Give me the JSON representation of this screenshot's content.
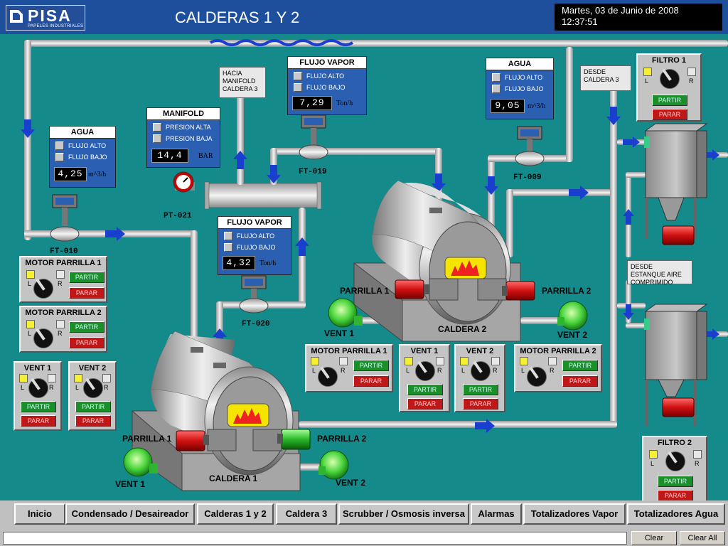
{
  "header": {
    "logo_text": "PISA",
    "logo_sub": "PAPELES INDUSTRIALES",
    "title": "CALDERAS 1 Y 2",
    "date": "Martes, 03 de Junio de 2008",
    "time": "12:37:51"
  },
  "indicators": {
    "agua_1": {
      "title": "AGUA",
      "alto": "FLUJO ALTO",
      "bajo": "FLUJO BAJO",
      "value": "4,25",
      "unit": "m^3/h"
    },
    "manifold": {
      "title": "MANIFOLD",
      "alto": "PRESION ALTA",
      "bajo": "PRESION BAJA",
      "value": "14,4",
      "unit": "BAR"
    },
    "vapor_2": {
      "title": "FLUJO VAPOR",
      "alto": "FLUJO ALTO",
      "bajo": "FLUJO BAJO",
      "value": "7,29",
      "unit": "Ton/h"
    },
    "agua_2": {
      "title": "AGUA",
      "alto": "FLUJO ALTO",
      "bajo": "FLUJO BAJO",
      "value": "9,05",
      "unit": "m^3/h"
    },
    "vapor_1": {
      "title": "FLUJO VAPOR",
      "alto": "FLUJO ALTO",
      "bajo": "FLUJO BAJO",
      "value": "4,32",
      "unit": "Ton/h"
    }
  },
  "tags": {
    "ft010": "FT-010",
    "ft019": "FT-019",
    "ft009": "FT-009",
    "ft020": "FT-020",
    "pt021": "PT-021"
  },
  "notes": {
    "hacia": "HACIA MANIFOLD CALDERA 3",
    "desde_cal3": "DESDE CALDERA 3",
    "desde_estanque": "DESDE ESTANQUE AIRE COMPRIMIDO"
  },
  "labels": {
    "caldera1": "CALDERA 1",
    "caldera2": "CALDERA 2",
    "parrilla1": "PARRILLA 1",
    "parrilla2": "PARRILLA 2",
    "vent1": "VENT 1",
    "vent2": "VENT 2"
  },
  "controls": {
    "l": "L",
    "r": "R",
    "partir": "PARTIR",
    "parar": "PARAR",
    "motor_p1": "MOTOR PARRILLA 1",
    "motor_p2": "MOTOR PARRILLA 2",
    "vent1": "VENT 1",
    "vent2": "VENT 2",
    "filtro1": "FILTRO  1",
    "filtro2": "FILTRO  2"
  },
  "nav": {
    "items": [
      "Inicio",
      "Condensado / Desaireador",
      "Calderas 1 y 2",
      "Caldera 3",
      "Scrubber / Osmosis inversa",
      "Alarmas",
      "Totalizadores Vapor",
      "Totalizadores Agua"
    ]
  },
  "status": {
    "clear": "Clear",
    "clear_all": "Clear All"
  },
  "colors": {
    "background": "#158a8a",
    "header": "#1e4f9c",
    "indicator": "#2b5fb2",
    "start": "#1a8f2a",
    "stop": "#c01818",
    "flow_arrow": "#1a3fcf"
  }
}
